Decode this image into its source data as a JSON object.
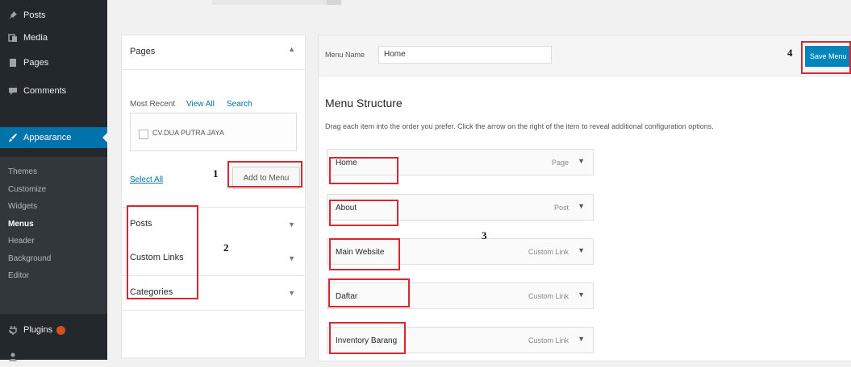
{
  "sidebar": {
    "items": [
      {
        "label": "Posts",
        "icon": "pin-icon"
      },
      {
        "label": "Media",
        "icon": "media-icon"
      },
      {
        "label": "Pages",
        "icon": "pages-icon"
      },
      {
        "label": "Comments",
        "icon": "comments-icon"
      },
      {
        "label": "Appearance",
        "icon": "paintbrush-icon"
      },
      {
        "label": "Plugins",
        "icon": "plugin-icon"
      }
    ],
    "submenu": [
      "Themes",
      "Customize",
      "Widgets",
      "Menus",
      "Header",
      "Background",
      "Editor"
    ],
    "current_submenu": "Menus"
  },
  "add_items": {
    "pages": {
      "title": "Pages",
      "tabs": [
        "Most Recent",
        "View All",
        "Search"
      ],
      "items": [
        "CV.DUA PUTRA JAYA"
      ],
      "select_all": "Select All",
      "add_button": "Add to Menu"
    },
    "sections": [
      "Posts",
      "Custom Links",
      "Categories"
    ]
  },
  "menu_editor": {
    "name_label": "Menu Name",
    "name_value": "Home",
    "save_button": "Save Menu",
    "structure_title": "Menu Structure",
    "structure_desc": "Drag each item into the order you prefer. Click the arrow on the right of the item to reveal additional configuration options.",
    "items": [
      {
        "title": "Home",
        "type": "Page"
      },
      {
        "title": "About",
        "type": "Post"
      },
      {
        "title": "Main Website",
        "type": "Custom Link"
      },
      {
        "title": "Daftar",
        "type": "Custom Link"
      },
      {
        "title": "Inventory Barang",
        "type": "Custom Link"
      }
    ]
  },
  "annotations": [
    "1",
    "2",
    "3",
    "4"
  ],
  "colors": {
    "sidebar_bg": "#23282d",
    "accent": "#0073aa",
    "save_button": "#0085ba",
    "highlight": "#d7282f"
  }
}
